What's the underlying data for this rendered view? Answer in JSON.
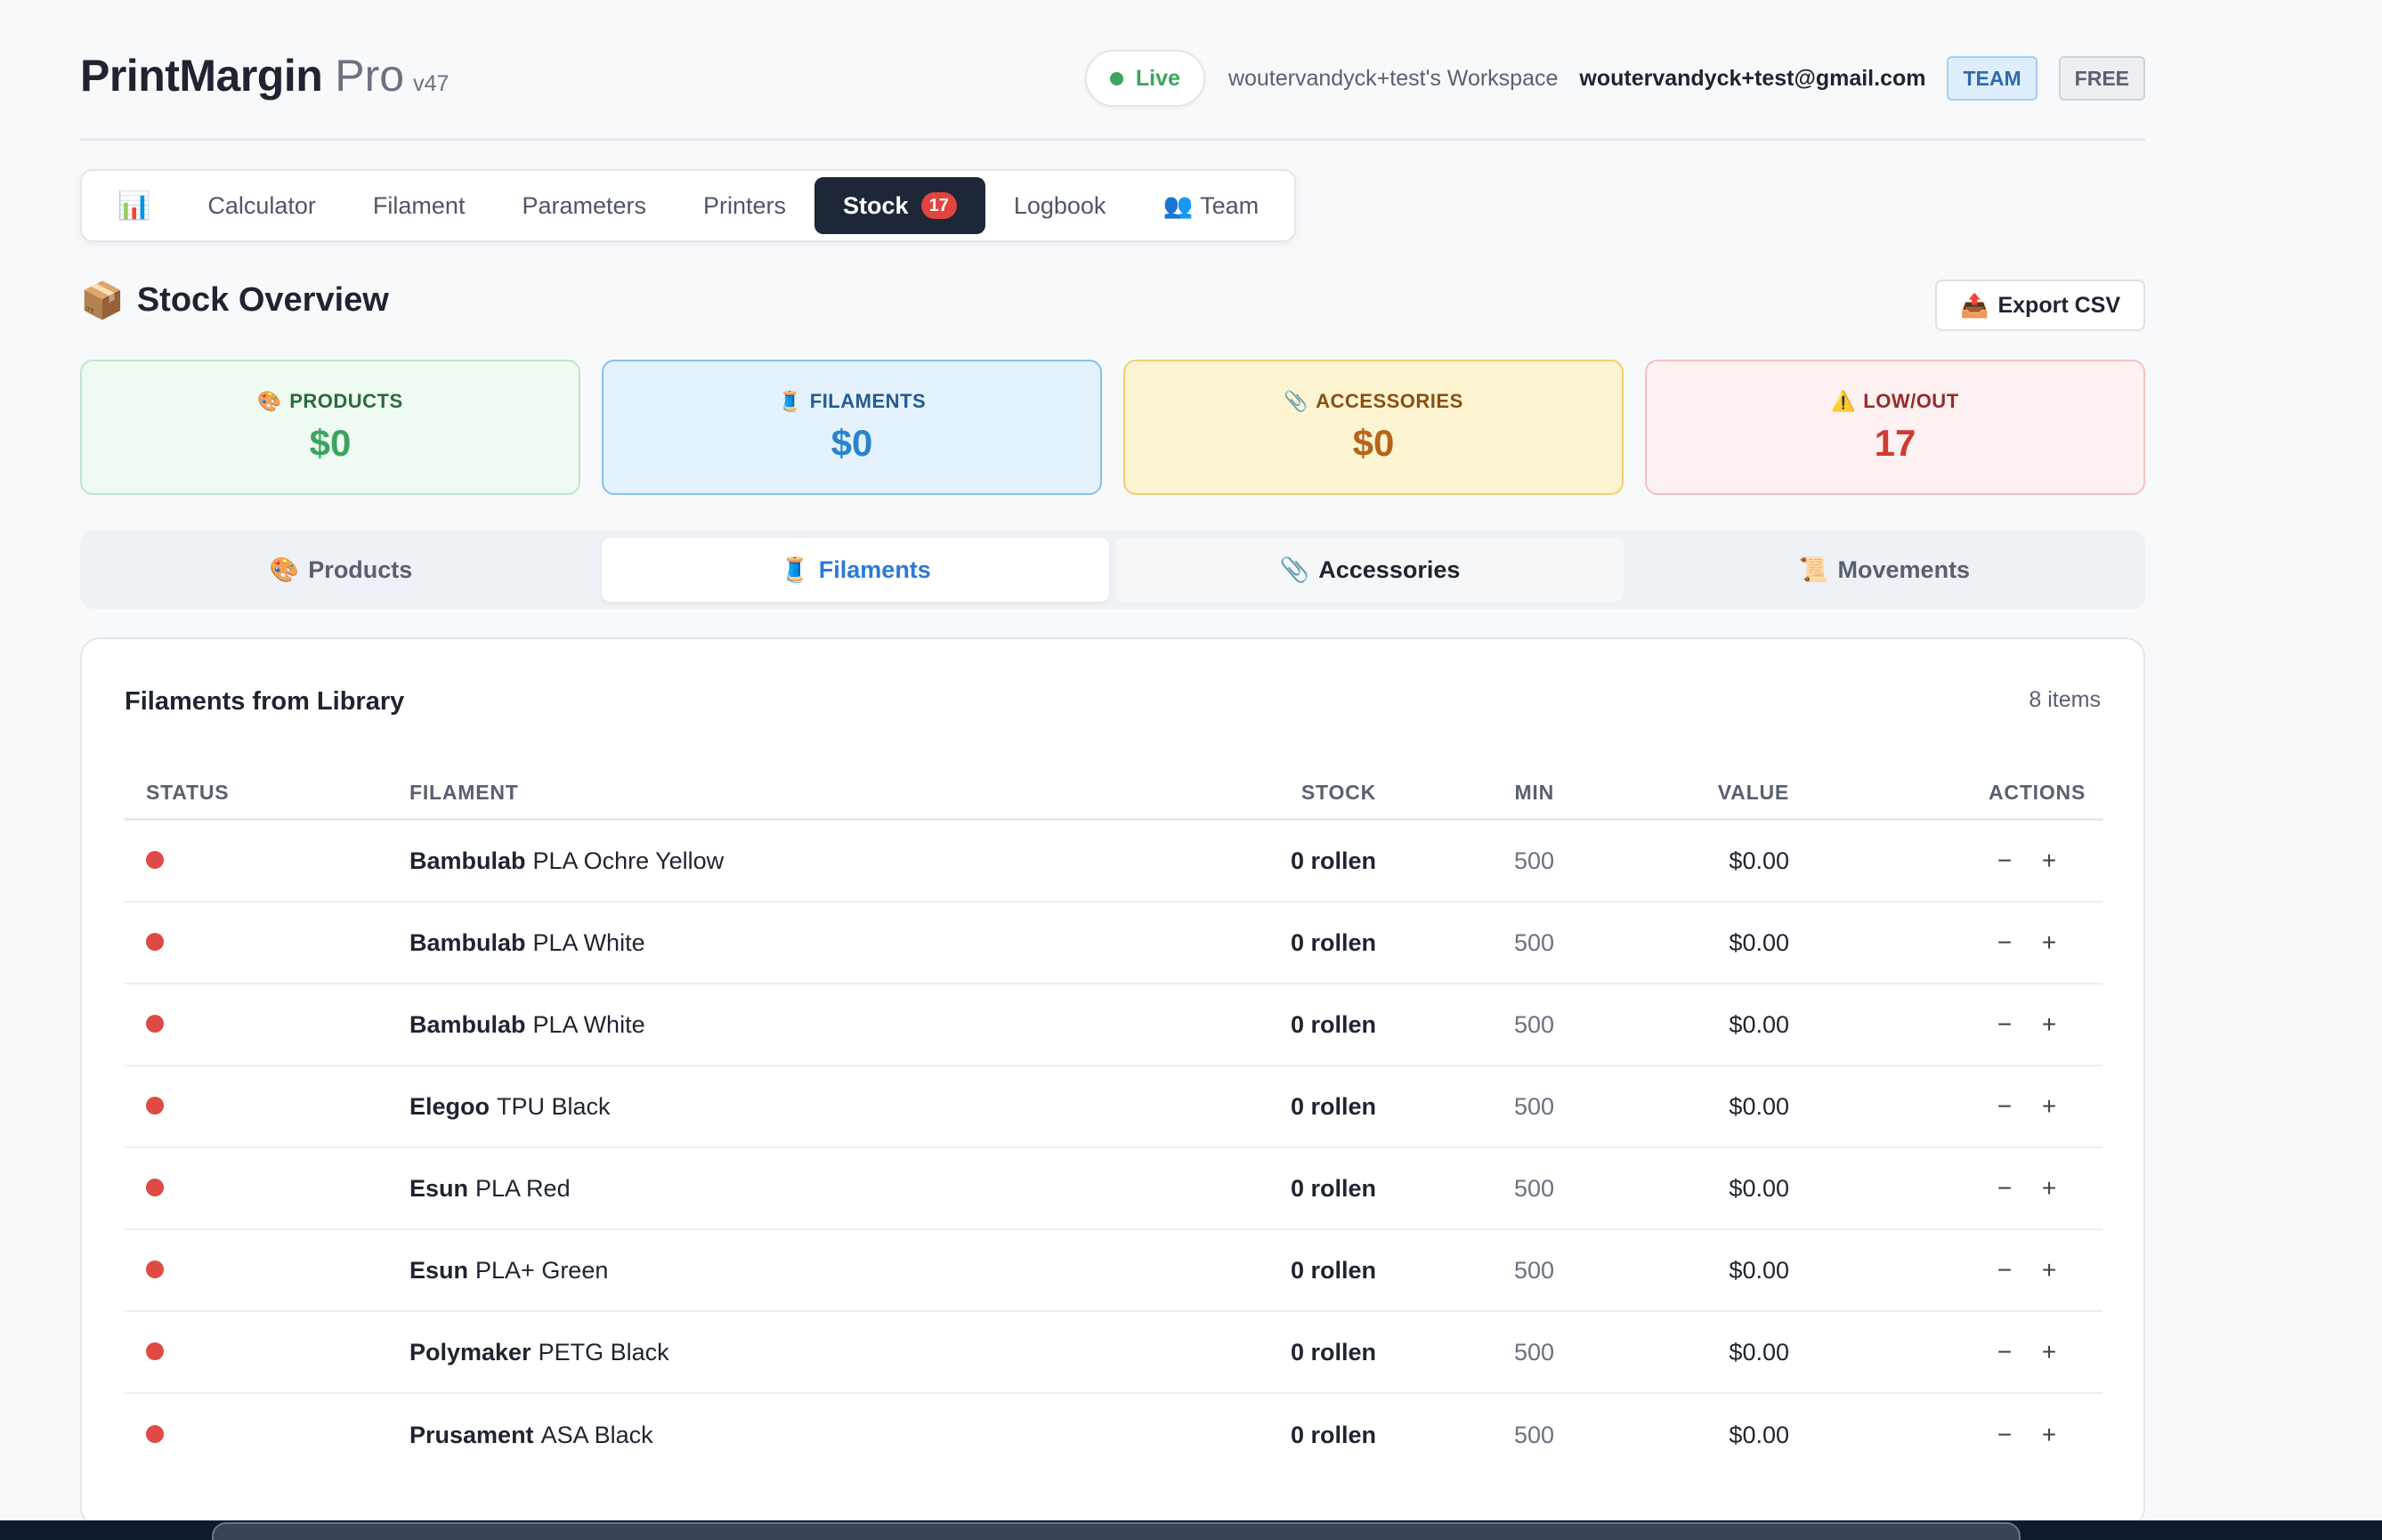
{
  "header": {
    "brand": "PrintMargin",
    "edition": "Pro",
    "version": "v47",
    "status": "Live",
    "workspace": "woutervandyck+test's Workspace",
    "email": "woutervandyck+test@gmail.com",
    "badge_team": "TEAM",
    "badge_free": "FREE"
  },
  "nav": {
    "dashboard_icon": "📊",
    "items": [
      "Calculator",
      "Filament",
      "Parameters",
      "Printers",
      "Stock",
      "Logbook",
      "Team"
    ],
    "stock_count": "17",
    "team_icon": "👥",
    "active": "Stock"
  },
  "page": {
    "title_icon": "📦",
    "title": "Stock Overview",
    "export_icon": "📤",
    "export_label": "Export CSV"
  },
  "stats": [
    {
      "icon": "🎨",
      "label": "PRODUCTS",
      "value": "$0",
      "color": "#3aa55d"
    },
    {
      "icon": "🧵",
      "label": "FILAMENTS",
      "value": "$0",
      "color": "#2a83cc"
    },
    {
      "icon": "📎",
      "label": "ACCESSORIES",
      "value": "$0",
      "color": "#b5651a"
    },
    {
      "icon": "⚠️",
      "label": "LOW/OUT",
      "value": "17",
      "color": "#cf3b34"
    }
  ],
  "subtabs": [
    {
      "icon": "🎨",
      "label": "Products"
    },
    {
      "icon": "🧵",
      "label": "Filaments"
    },
    {
      "icon": "📎",
      "label": "Accessories"
    },
    {
      "icon": "📜",
      "label": "Movements"
    }
  ],
  "table": {
    "title": "Filaments from Library",
    "count": "8 items",
    "headers": {
      "status": "STATUS",
      "filament": "FILAMENT",
      "stock": "STOCK",
      "min": "MIN",
      "value": "VALUE",
      "actions": "ACTIONS"
    },
    "rows": [
      {
        "brand": "Bambulab",
        "name": "PLA Ochre Yellow",
        "stock": "0 rollen",
        "min": "500",
        "value": "$0.00"
      },
      {
        "brand": "Bambulab",
        "name": "PLA White",
        "stock": "0 rollen",
        "min": "500",
        "value": "$0.00"
      },
      {
        "brand": "Bambulab",
        "name": "PLA White",
        "stock": "0 rollen",
        "min": "500",
        "value": "$0.00"
      },
      {
        "brand": "Elegoo",
        "name": "TPU Black",
        "stock": "0 rollen",
        "min": "500",
        "value": "$0.00"
      },
      {
        "brand": "Esun",
        "name": "PLA Red",
        "stock": "0 rollen",
        "min": "500",
        "value": "$0.00"
      },
      {
        "brand": "Esun",
        "name": "PLA+ Green",
        "stock": "0 rollen",
        "min": "500",
        "value": "$0.00"
      },
      {
        "brand": "Polymaker",
        "name": "PETG Black",
        "stock": "0 rollen",
        "min": "500",
        "value": "$0.00"
      },
      {
        "brand": "Prusament",
        "name": "ASA Black",
        "stock": "0 rollen",
        "min": "500",
        "value": "$0.00"
      }
    ],
    "minus": "−",
    "plus": "+"
  }
}
